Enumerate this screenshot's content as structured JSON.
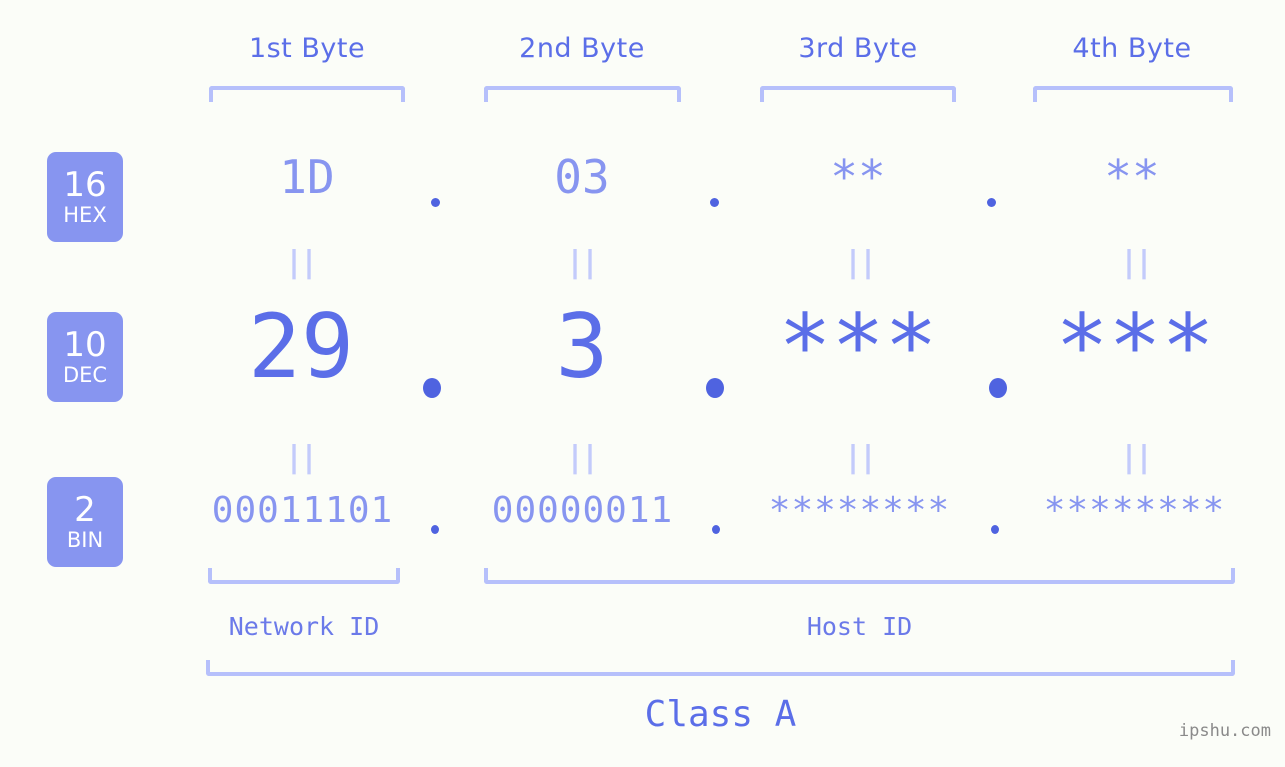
{
  "meta": {
    "watermark": "ipshu.com"
  },
  "headers": [
    {
      "label": "1st Byte"
    },
    {
      "label": "2nd Byte"
    },
    {
      "label": "3rd Byte"
    },
    {
      "label": "4th Byte"
    }
  ],
  "bases": [
    {
      "num": "16",
      "name": "HEX"
    },
    {
      "num": "10",
      "name": "DEC"
    },
    {
      "num": "2",
      "name": "BIN"
    }
  ],
  "rows": {
    "hex": {
      "b1": "1D",
      "b2": "03",
      "b3": "**",
      "b4": "**"
    },
    "dec": {
      "b1": "29",
      "b2": "3",
      "b3": "***",
      "b4": "***"
    },
    "bin": {
      "b1": "00011101",
      "b2": "00000011",
      "b3": "********",
      "b4": "********"
    }
  },
  "separators": {
    "dot": "."
  },
  "equals": {
    "mark": "||"
  },
  "footer": {
    "network_id": "Network ID",
    "host_id": "Host ID",
    "class": "Class A"
  },
  "colors": {
    "background": "#fbfdf8",
    "accent_dark": "#5b6ee8",
    "accent_mid": "#8795f0",
    "accent_light": "#b6c0fb",
    "badge_text": "#ffffff",
    "watermark": "#8a8a8a"
  }
}
